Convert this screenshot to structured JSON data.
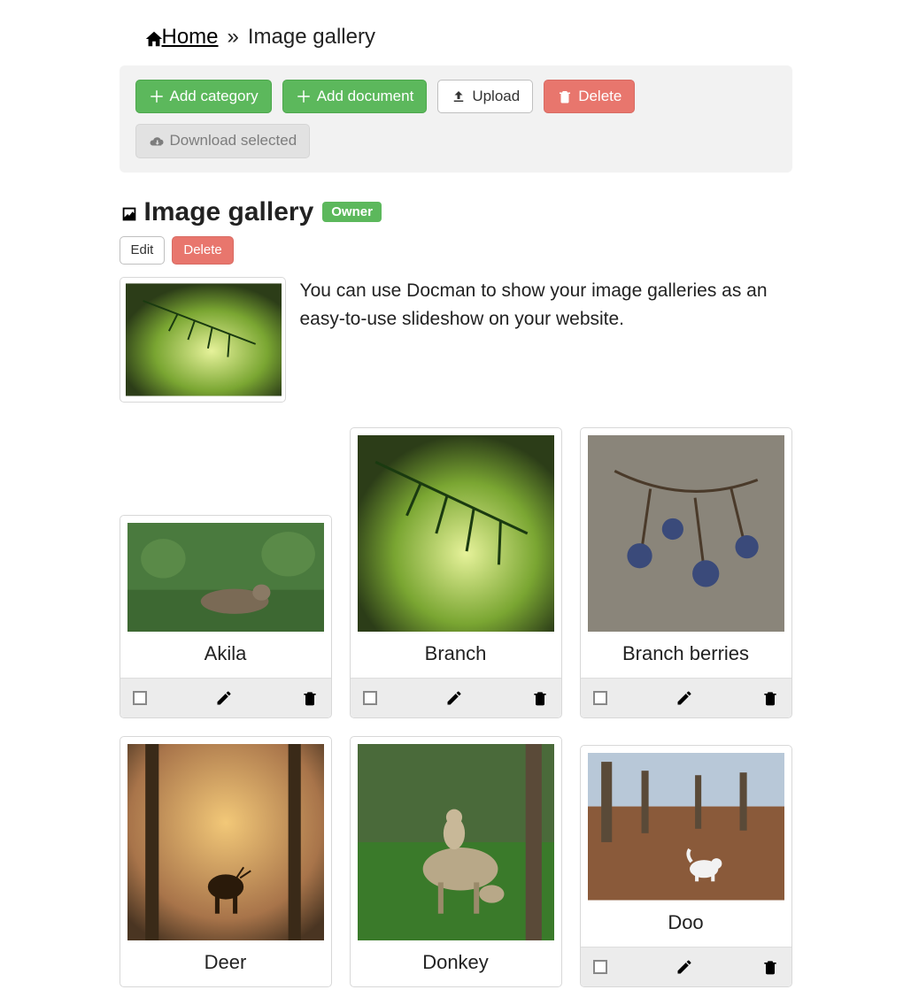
{
  "breadcrumb": {
    "home": "Home",
    "sep": "»",
    "current": "Image gallery"
  },
  "toolbar": {
    "add_category": "Add category",
    "add_document": "Add document",
    "upload": "Upload",
    "delete": "Delete",
    "download_selected": "Download selected"
  },
  "page": {
    "title": "Image gallery",
    "badge": "Owner",
    "edit": "Edit",
    "delete": "Delete",
    "description": "You can use Docman to show your image galleries as an easy-to-use slideshow on your website."
  },
  "cards": [
    {
      "title": "Akila"
    },
    {
      "title": "Branch"
    },
    {
      "title": "Branch berries"
    },
    {
      "title": "Deer"
    },
    {
      "title": "Donkey"
    },
    {
      "title": "Doo"
    }
  ]
}
